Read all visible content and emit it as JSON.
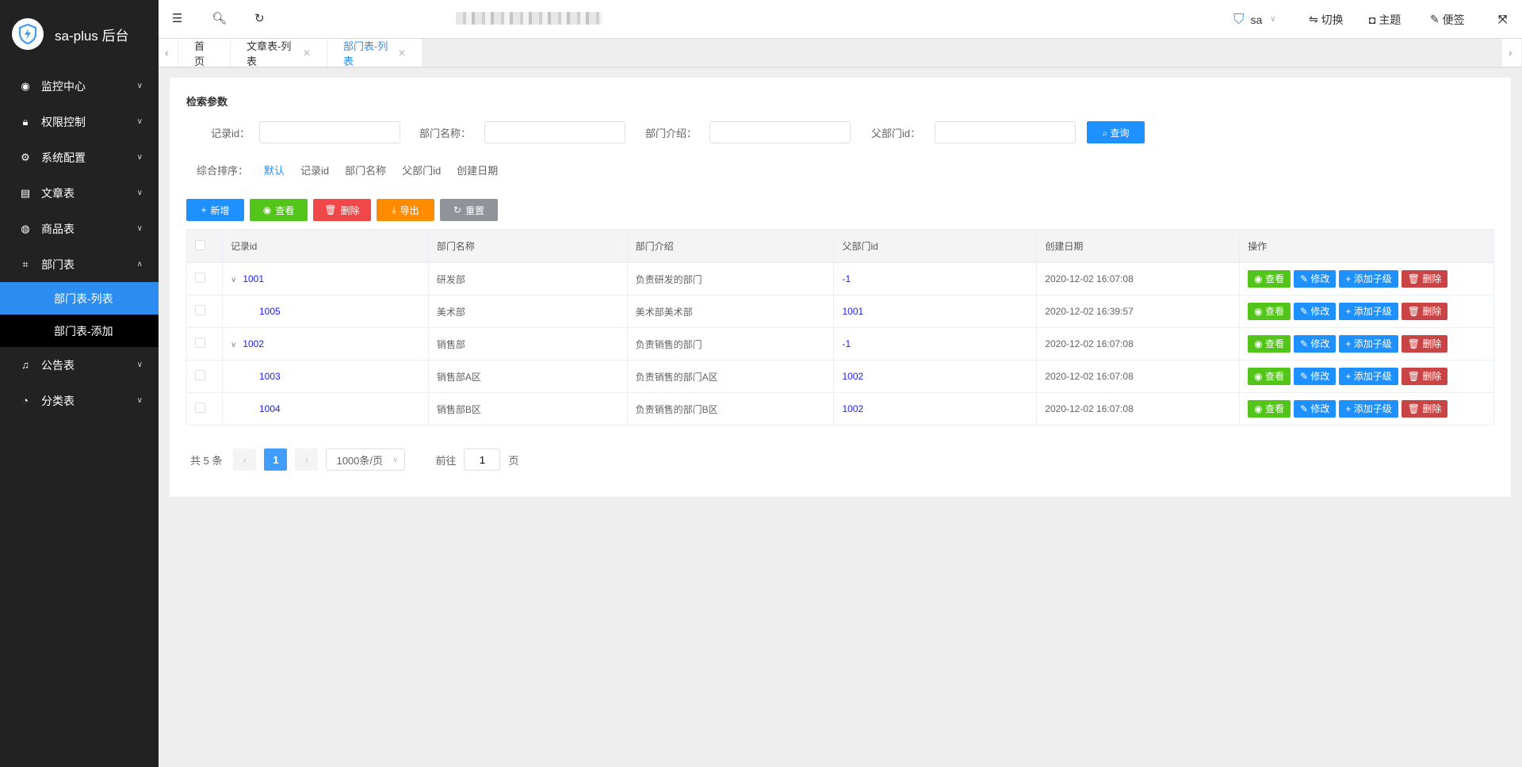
{
  "app": {
    "title": "sa-plus 后台"
  },
  "sidebar": {
    "items": [
      {
        "label": "监控中心",
        "icon": "eye-icon"
      },
      {
        "label": "权限控制",
        "icon": "lock-icon"
      },
      {
        "label": "系统配置",
        "icon": "gear-icon"
      },
      {
        "label": "文章表",
        "icon": "document-icon"
      },
      {
        "label": "商品表",
        "icon": "apple-icon"
      },
      {
        "label": "部门表",
        "icon": "crop-icon"
      }
    ],
    "subitems": [
      {
        "label": "部门表-列表",
        "active": true
      },
      {
        "label": "部门表-添加"
      }
    ],
    "items_after": [
      {
        "label": "公告表",
        "icon": "bell-icon"
      },
      {
        "label": "分类表",
        "icon": "chart-icon"
      }
    ]
  },
  "header": {
    "user": "sa",
    "switch": "切换",
    "theme": "主题",
    "note": "便签"
  },
  "tabs": [
    {
      "label": "首页"
    },
    {
      "label": "文章表-列表"
    },
    {
      "label": "部门表-列表",
      "active": true
    }
  ],
  "search": {
    "title": "检索参数",
    "fields": [
      {
        "label": "记录id：",
        "value": ""
      },
      {
        "label": "部门名称：",
        "value": ""
      },
      {
        "label": "部门介绍：",
        "value": ""
      },
      {
        "label": "父部门id：",
        "value": ""
      }
    ],
    "query_button": "查询"
  },
  "sort": {
    "label": "综合排序：",
    "options": [
      "默认",
      "记录id",
      "部门名称",
      "父部门id",
      "创建日期"
    ],
    "active": "默认"
  },
  "toolbar": [
    {
      "label": "新增",
      "icon": "plus-icon",
      "color": "#1e90ff"
    },
    {
      "label": "查看",
      "icon": "eye-icon",
      "color": "#52c41a"
    },
    {
      "label": "删除",
      "icon": "trash-icon",
      "color": "#f04848"
    },
    {
      "label": "导出",
      "icon": "download-icon",
      "color": "#ff8c00"
    },
    {
      "label": "重置",
      "icon": "refresh-icon",
      "color": "#909399"
    }
  ],
  "table": {
    "columns": [
      "记录id",
      "部门名称",
      "部门介绍",
      "父部门id",
      "创建日期",
      "操作"
    ],
    "rows": [
      {
        "id": "1001",
        "name": "研发部",
        "intro": "负责研发的部门",
        "parent": "-1",
        "date": "2020-12-02 16:07:08",
        "expand": true,
        "level": 0
      },
      {
        "id": "1005",
        "name": "美术部",
        "intro": "美术部美术部",
        "parent": "1001",
        "date": "2020-12-02 16:39:57",
        "level": 1
      },
      {
        "id": "1002",
        "name": "销售部",
        "intro": "负责销售的部门",
        "parent": "-1",
        "date": "2020-12-02 16:07:08",
        "expand": true,
        "level": 0
      },
      {
        "id": "1003",
        "name": "销售部A区",
        "intro": "负责销售的部门A区",
        "parent": "1002",
        "date": "2020-12-02 16:07:08",
        "level": 1
      },
      {
        "id": "1004",
        "name": "销售部B区",
        "intro": "负责销售的部门B区",
        "parent": "1002",
        "date": "2020-12-02 16:07:08",
        "level": 1
      }
    ],
    "actions": [
      {
        "label": "查看",
        "color": "#52c41a",
        "icon": "eye-icon"
      },
      {
        "label": "修改",
        "color": "#1e90ff",
        "icon": "pencil-icon"
      },
      {
        "label": "添加子级",
        "color": "#1e90ff",
        "icon": "plus-icon"
      },
      {
        "label": "删除",
        "color": "#c94444",
        "icon": "trash-icon"
      }
    ]
  },
  "pagination": {
    "total": "共 5 条",
    "current": "1",
    "page_size": "1000条/页",
    "goto_label": "前往",
    "goto_value": "1",
    "page_suffix": "页"
  }
}
